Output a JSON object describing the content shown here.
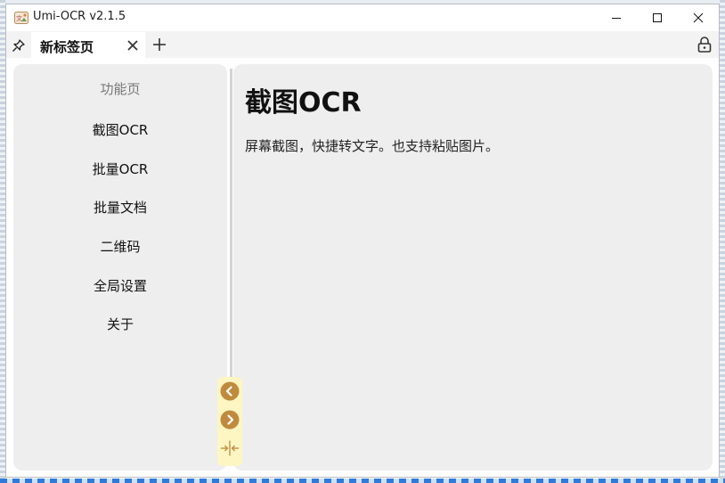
{
  "window": {
    "title": "Umi-OCR v2.1.5"
  },
  "tabs": {
    "active_label": "新标签页"
  },
  "sidebar": {
    "header": "功能页",
    "items": [
      {
        "label": "截图OCR"
      },
      {
        "label": "批量OCR"
      },
      {
        "label": "批量文档"
      },
      {
        "label": "二维码"
      },
      {
        "label": "全局设置"
      },
      {
        "label": "关于"
      }
    ]
  },
  "main": {
    "title": "截图OCR",
    "description": "屏幕截图，快捷转文字。也支持粘贴图片。"
  },
  "icons": {
    "app": "umi-ocr-app-icon",
    "pin": "pin-icon",
    "close_tab": "close-icon",
    "add_tab": "plus-icon",
    "lock": "lock-icon",
    "prev": "chevron-left-icon",
    "next": "chevron-right-icon",
    "collapse": "collapse-arrows-icon"
  },
  "colors": {
    "panel_bg": "#eeeeee",
    "control_bg": "#fdf6c3",
    "control_accent": "#c08a3e"
  }
}
